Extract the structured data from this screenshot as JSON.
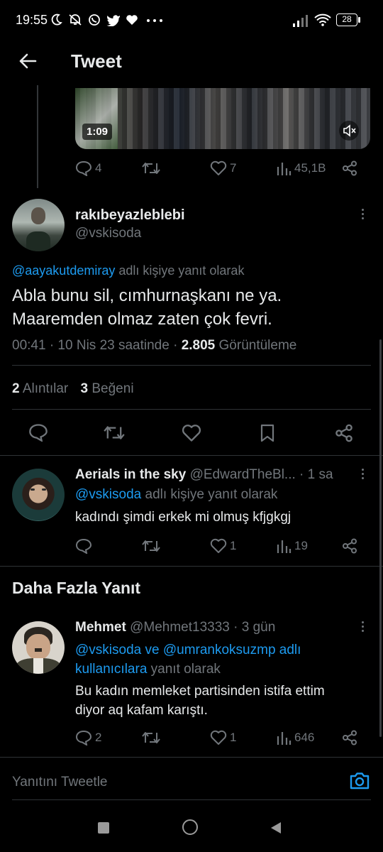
{
  "status_bar": {
    "time": "19:55",
    "battery": "28"
  },
  "header": {
    "title": "Tweet"
  },
  "prev_tweet": {
    "video_duration": "1:09",
    "replies": "4",
    "likes": "7",
    "views": "45,1B"
  },
  "main_tweet": {
    "display_name": "rakıbeyazleblebi",
    "handle": "@vskisoda",
    "reply_to_handle": "@aayakutdemiray",
    "reply_to_suffix": "adlı kişiye yanıt olarak",
    "text_line1": "Abla bunu sil, cımhurnaşkanı ne ya.",
    "text_line2": "Maaremden olmaz zaten çok fevri.",
    "timestamp": "00:41 · 10 Nis 23 saatinde ·",
    "views_count": "2.805",
    "views_label": "Görüntüleme",
    "quotes_count": "2",
    "quotes_label": "Alıntılar",
    "likes_count": "3",
    "likes_label": "Beğeni"
  },
  "reply1": {
    "display_name": "Aerials in the sky",
    "handle": "@EdwardTheBl...",
    "time": "· 1 sa",
    "reply_to_handle": "@vskisoda",
    "reply_to_suffix": "adlı kişiye yanıt olarak",
    "text": "kadındı şimdi erkek mi olmuş kfjgkgj",
    "likes": "1",
    "views": "19"
  },
  "more_replies": {
    "title": "Daha Fazla Yanıt"
  },
  "reply2": {
    "display_name": "Mehmet",
    "handle": "@Mehmet13333",
    "time": "· 3 gün",
    "reply_to_line1": "@vskisoda ve @umrankoksuzmp adlı",
    "reply_to_line2_link": "kullanıcılara",
    "reply_to_line2_suffix": "yanıt olarak",
    "text_line1": "Bu kadın memleket partisinden istifa ettim",
    "text_line2": "diyor aq kafam karıştı.",
    "replies": "2",
    "likes": "1",
    "views": "646"
  },
  "composer": {
    "placeholder": "Yanıtını Tweetle"
  },
  "colors": {
    "accent": "#1d9bf0",
    "muted": "#71767b",
    "divider": "#2f3336"
  }
}
